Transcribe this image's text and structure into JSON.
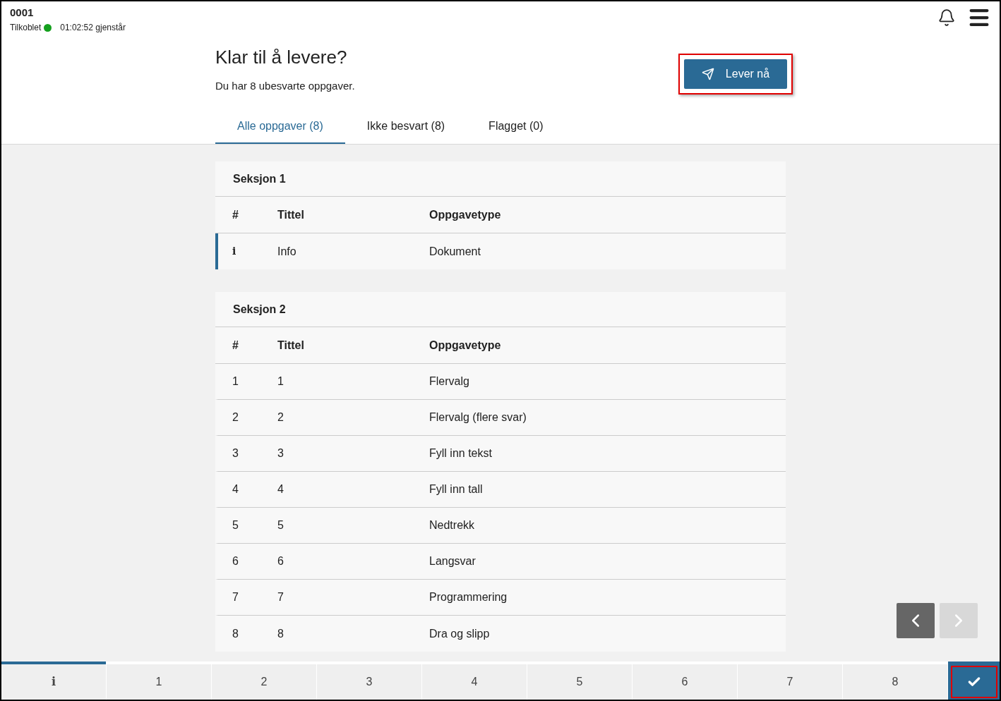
{
  "header": {
    "candidate": "0001",
    "status": "Tilkoblet",
    "connected": true,
    "time_left": "01:02:52 gjenstår"
  },
  "title": "Klar til å levere?",
  "subtitle": "Du har 8 ubesvarte oppgaver.",
  "submit_button": {
    "label": "Lever nå",
    "highlighted": true
  },
  "tabs": [
    {
      "label": "Alle oppgaver (8)",
      "selected": true
    },
    {
      "label": "Ikke besvart (8)",
      "selected": false
    },
    {
      "label": "Flagget (0)",
      "selected": false
    }
  ],
  "sections": [
    {
      "title": "Seksjon 1",
      "columns": [
        "#",
        "Tittel",
        "Oppgavetype"
      ],
      "rows": [
        {
          "number": "i",
          "kind": "info",
          "title": "Info",
          "type": "Dokument",
          "selected": true
        }
      ]
    },
    {
      "title": "Seksjon 2",
      "columns": [
        "#",
        "Tittel",
        "Oppgavetype"
      ],
      "rows": [
        {
          "number": "1",
          "kind": "task",
          "title": "1",
          "type": "Flervalg",
          "selected": false
        },
        {
          "number": "2",
          "kind": "task",
          "title": "2",
          "type": "Flervalg (flere svar)",
          "selected": false
        },
        {
          "number": "3",
          "kind": "task",
          "title": "3",
          "type": "Fyll inn tekst",
          "selected": false
        },
        {
          "number": "4",
          "kind": "task",
          "title": "4",
          "type": "Fyll inn tall",
          "selected": false
        },
        {
          "number": "5",
          "kind": "task",
          "title": "5",
          "type": "Nedtrekk",
          "selected": false
        },
        {
          "number": "6",
          "kind": "task",
          "title": "6",
          "type": "Langsvar",
          "selected": false
        },
        {
          "number": "7",
          "kind": "task",
          "title": "7",
          "type": "Programmering",
          "selected": false
        },
        {
          "number": "8",
          "kind": "task",
          "title": "8",
          "type": "Dra og slipp",
          "selected": false
        }
      ]
    }
  ],
  "pager": {
    "prev_disabled": false,
    "next_disabled": true
  },
  "bottom_nav": [
    {
      "label": "i",
      "kind": "info",
      "selected": true
    },
    {
      "label": "1",
      "kind": "task",
      "selected": false
    },
    {
      "label": "2",
      "kind": "task",
      "selected": false
    },
    {
      "label": "3",
      "kind": "task",
      "selected": false
    },
    {
      "label": "4",
      "kind": "task",
      "selected": false
    },
    {
      "label": "5",
      "kind": "task",
      "selected": false
    },
    {
      "label": "6",
      "kind": "task",
      "selected": false
    },
    {
      "label": "7",
      "kind": "task",
      "selected": false
    },
    {
      "label": "8",
      "kind": "task",
      "selected": false
    }
  ],
  "finish_button": {
    "highlighted": true
  }
}
